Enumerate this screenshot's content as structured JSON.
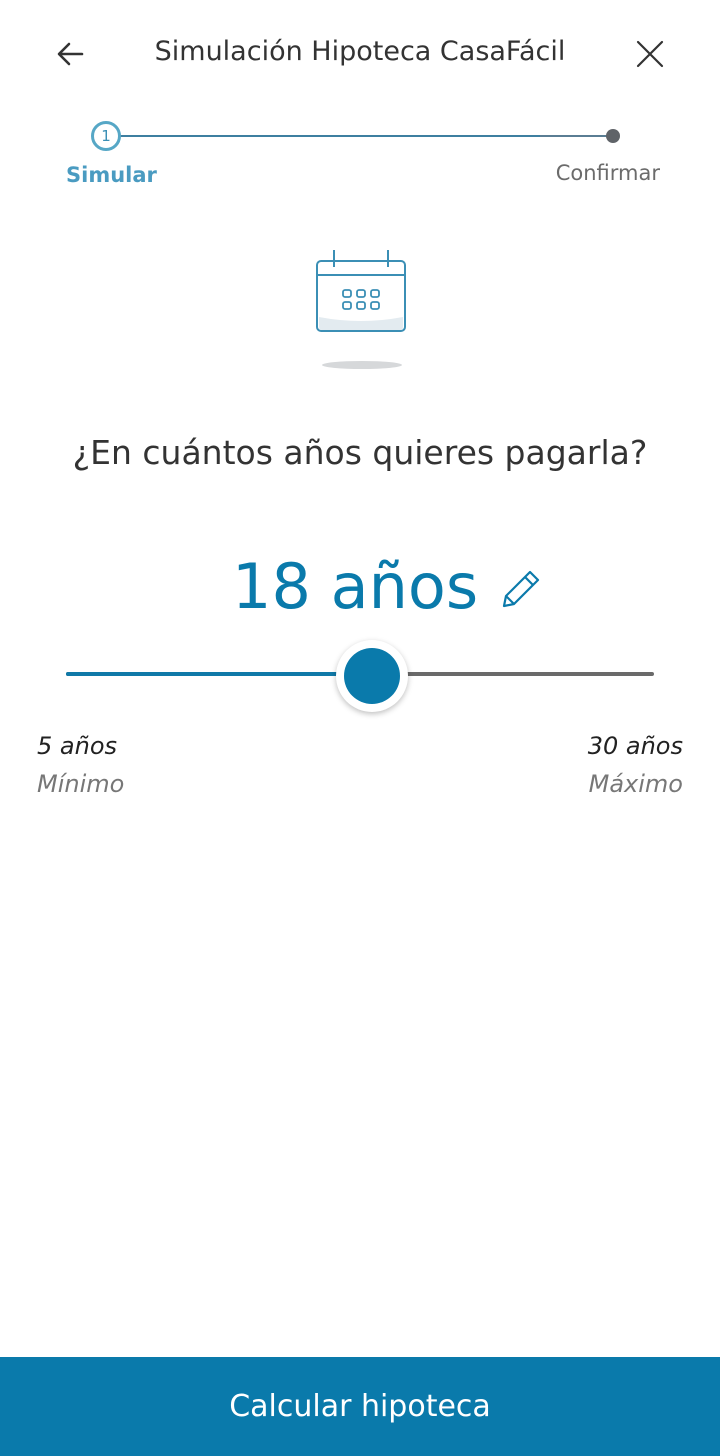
{
  "header": {
    "title": "Simulación Hipoteca CasaFácil",
    "back_icon": "arrow-left-icon",
    "close_icon": "close-icon"
  },
  "stepper": {
    "steps": [
      {
        "number": "1",
        "label": "Simular",
        "state": "active"
      },
      {
        "label": "Confirmar",
        "state": "pending"
      }
    ]
  },
  "illustration": {
    "icon": "calendar-icon"
  },
  "question": "¿En cuántos años quieres pagarla?",
  "slider": {
    "value_label": "18 años",
    "value": 18,
    "min": 5,
    "max": 30,
    "min_label": "5 años",
    "min_caption": "Mínimo",
    "max_label": "30 años",
    "max_caption": "Máximo",
    "edit_icon": "pencil-icon"
  },
  "cta": {
    "label": "Calcular hipoteca"
  },
  "colors": {
    "primary": "#0a7aab",
    "step_active": "#56a7c6",
    "track_inactive": "#6a6a6a"
  }
}
